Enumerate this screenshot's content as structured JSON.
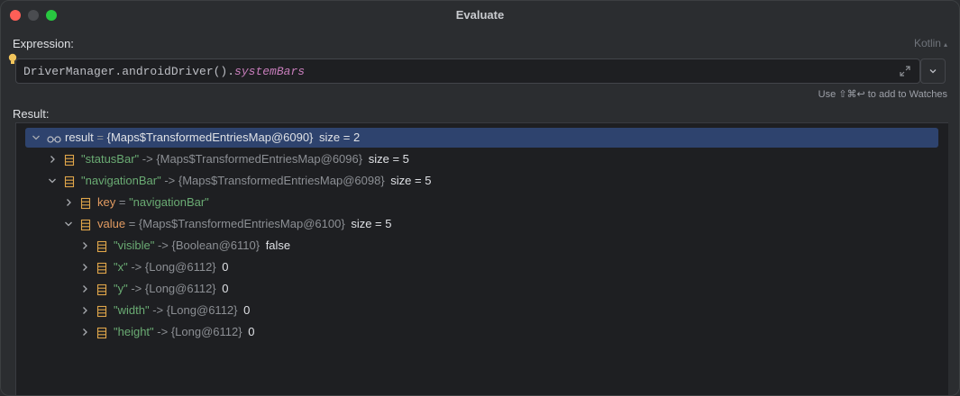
{
  "window": {
    "title": "Evaluate"
  },
  "expression": {
    "label": "Expression:",
    "language": "Kotlin",
    "code_prefix": "DriverManager.androidDriver().",
    "code_property": "systemBars",
    "hint": "Use ⇧⌘↩ to add to Watches"
  },
  "result": {
    "label": "Result:",
    "rows": [
      {
        "indent": 0,
        "expanded": true,
        "icon": "glasses-icon",
        "key": "result",
        "key_kind": "plain",
        "arrow": " = ",
        "value": "{Maps$TransformedEntriesMap@6090}",
        "value_kind": "white",
        "suffix": "size = 2",
        "selected": true
      },
      {
        "indent": 1,
        "expanded": false,
        "icon": "entry-icon",
        "key": "\"statusBar\"",
        "key_kind": "str",
        "arrow": " -> ",
        "value": "{Maps$TransformedEntriesMap@6096}",
        "value_kind": "gray",
        "suffix": "size = 5"
      },
      {
        "indent": 1,
        "expanded": true,
        "icon": "entry-icon",
        "key": "\"navigationBar\"",
        "key_kind": "str",
        "arrow": " -> ",
        "value": "{Maps$TransformedEntriesMap@6098}",
        "value_kind": "gray",
        "suffix": "size = 5"
      },
      {
        "indent": 2,
        "expanded": false,
        "icon": "entry-icon",
        "key": "key",
        "key_kind": "orange",
        "arrow": " = ",
        "value": "\"navigationBar\"",
        "value_kind": "str",
        "suffix": ""
      },
      {
        "indent": 2,
        "expanded": true,
        "icon": "entry-icon",
        "key": "value",
        "key_kind": "orange",
        "arrow": " = ",
        "value": "{Maps$TransformedEntriesMap@6100}",
        "value_kind": "gray",
        "suffix": "size = 5"
      },
      {
        "indent": 3,
        "expanded": false,
        "icon": "entry-icon",
        "key": "\"visible\"",
        "key_kind": "str",
        "arrow": " -> ",
        "value": "{Boolean@6110}",
        "value_kind": "gray",
        "suffix": "false"
      },
      {
        "indent": 3,
        "expanded": false,
        "icon": "entry-icon",
        "key": "\"x\"",
        "key_kind": "str",
        "arrow": " -> ",
        "value": "{Long@6112}",
        "value_kind": "gray",
        "suffix": "0"
      },
      {
        "indent": 3,
        "expanded": false,
        "icon": "entry-icon",
        "key": "\"y\"",
        "key_kind": "str",
        "arrow": " -> ",
        "value": "{Long@6112}",
        "value_kind": "gray",
        "suffix": "0"
      },
      {
        "indent": 3,
        "expanded": false,
        "icon": "entry-icon",
        "key": "\"width\"",
        "key_kind": "str",
        "arrow": " -> ",
        "value": "{Long@6112}",
        "value_kind": "gray",
        "suffix": "0"
      },
      {
        "indent": 3,
        "expanded": false,
        "icon": "entry-icon",
        "key": "\"height\"",
        "key_kind": "str",
        "arrow": " -> ",
        "value": "{Long@6112}",
        "value_kind": "gray",
        "suffix": "0"
      }
    ]
  },
  "colors": {
    "selection": "#2e436e",
    "string": "#6aab73",
    "field": "#e29b61",
    "property": "#c77dbb"
  }
}
